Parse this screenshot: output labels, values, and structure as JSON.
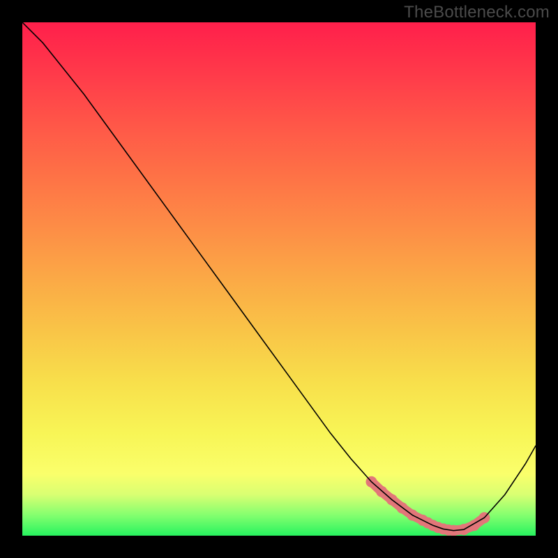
{
  "watermark": "TheBottleneck.com",
  "colors": {
    "background": "#000000",
    "gradient_top": "#ff1f4b",
    "gradient_bottom": "#27f35f",
    "curve": "#000000",
    "highlight": "#e27679"
  },
  "chart_data": {
    "type": "line",
    "title": "",
    "xlabel": "",
    "ylabel": "",
    "xlim": [
      0,
      100
    ],
    "ylim": [
      0,
      100
    ],
    "grid": false,
    "legend": false,
    "x": [
      0,
      4,
      8,
      12,
      16,
      20,
      24,
      28,
      32,
      36,
      40,
      44,
      48,
      52,
      56,
      60,
      64,
      68,
      72,
      76,
      78,
      80,
      82,
      84,
      86,
      90,
      94,
      98,
      100
    ],
    "values": [
      100,
      96,
      91,
      86,
      80.5,
      75,
      69.5,
      64,
      58.5,
      53,
      47.5,
      42,
      36.5,
      31,
      25.5,
      20,
      15,
      10.5,
      7,
      4,
      3,
      2,
      1.3,
      1,
      1.2,
      3.5,
      8,
      14,
      17.5
    ],
    "highlight": {
      "x": [
        68,
        70,
        72,
        74,
        76,
        78,
        79,
        80,
        81,
        82,
        83,
        84,
        86,
        88,
        90
      ],
      "values": [
        10.5,
        8.6,
        7,
        5.4,
        4,
        3,
        2.5,
        2,
        1.6,
        1.3,
        1.1,
        1,
        1.2,
        2.0,
        3.5
      ]
    }
  }
}
